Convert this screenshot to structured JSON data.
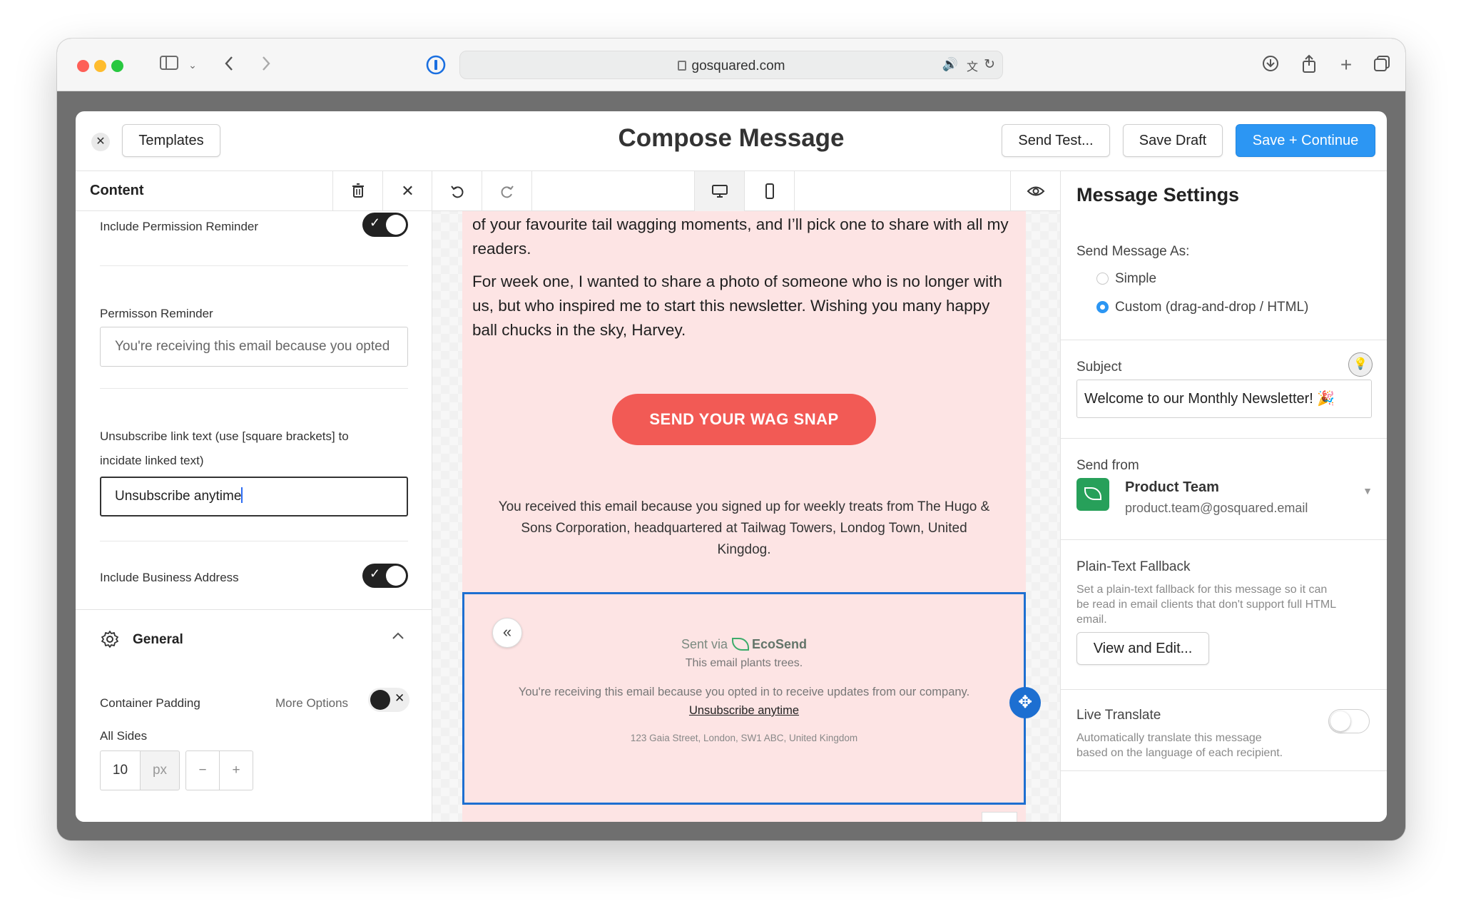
{
  "browser": {
    "url": "gosquared.com"
  },
  "modal": {
    "title": "Compose Message",
    "templates_label": "Templates",
    "send_test_label": "Send Test...",
    "save_draft_label": "Save Draft",
    "save_continue_label": "Save + Continue"
  },
  "left": {
    "tab_label": "Content",
    "permission_toggle_label": "Include Permission Reminder",
    "permission_toggle_on": true,
    "permission_field_label": "Permisson Reminder",
    "permission_field_placeholder": "You're receiving this email because you opted",
    "unsub_label_line1": "Unsubscribe link text (use [square brackets] to",
    "unsub_label_line2": "incidate linked text)",
    "unsub_value": "Unsubscribe anytime",
    "business_toggle_label": "Include Business Address",
    "business_toggle_on": true,
    "general_label": "General",
    "container_padding_label": "Container Padding",
    "more_options_label": "More Options",
    "all_sides_label": "All Sides",
    "padding_value": "10",
    "padding_unit": "px",
    "minus": "−",
    "plus": "+"
  },
  "email": {
    "para1_line1": "of your favourite tail wagging moments, and I’ll pick one to share with all my",
    "para1_line2": "readers.",
    "para2_line1": "For week one, I wanted to share a photo of someone who is no longer with",
    "para2_line2": "us, but who inspired me to start this newsletter. Wishing you many happy",
    "para2_line3": "ball chucks in the sky, Harvey.",
    "cta_label": "SEND YOUR WAG SNAP",
    "footer_line1": "You received this email because you signed up for weekly treats from The Hugo &",
    "footer_line2": "Sons Corporation, headquartered at Tailwag Towers, Londog Town, United",
    "footer_line3": "Kingdog.",
    "sent_via_prefix": "Sent via",
    "sent_via_brand": "EcoSend",
    "plants_trees": "This email plants trees.",
    "receiving_text": "You're receiving this email because you opted in to receive updates from our company.",
    "unsubscribe_link": "Unsubscribe anytime",
    "address": "123 Gaia Street, London, SW1 ABC, United Kingdom"
  },
  "right": {
    "title": "Message Settings",
    "send_as_label": "Send Message As:",
    "option_simple": "Simple",
    "option_custom": "Custom (drag-and-drop / HTML)",
    "selected_option": "custom",
    "subject_label": "Subject",
    "subject_value": "Welcome to our Monthly Newsletter! 🎉",
    "send_from_label": "Send from",
    "sender_name": "Product Team",
    "sender_email": "product.team@gosquared.email",
    "fallback_label": "Plain-Text Fallback",
    "fallback_desc_line1": "Set a plain-text fallback for this message so it can",
    "fallback_desc_line2": "be read in email clients that don't support full HTML",
    "fallback_desc_line3": "email.",
    "view_edit_label": "View and Edit...",
    "translate_label": "Live Translate",
    "translate_desc_line1": "Automatically translate this message",
    "translate_desc_line2": "based on the language of each recipient.",
    "translate_on": false
  },
  "icons": {
    "close": "close-icon",
    "trash": "trash-icon",
    "undo": "undo-icon",
    "redo": "redo-icon",
    "desktop": "desktop-icon",
    "mobile": "mobile-icon",
    "preview": "eye-icon",
    "settings": "gear-icon",
    "move": "move-icon",
    "lightbulb": "lightbulb-icon"
  },
  "colors": {
    "primary": "#2c96f3",
    "cta": "#f25a55",
    "email_bg": "#fde4e4",
    "selection": "#1d6fd1",
    "brand_green": "#27a05a"
  }
}
